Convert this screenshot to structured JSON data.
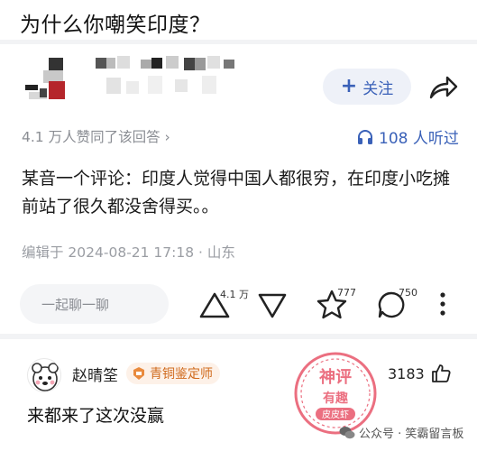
{
  "question": {
    "title": "为什么你嘲笑印度？"
  },
  "author": {
    "follow_label": "关注"
  },
  "stats": {
    "likes_text": "4.1 万人赞同了该回答 ›",
    "listen_text": "108 人听过"
  },
  "answer": {
    "body": "某音一个评论：印度人觉得中国人都很穷，在印度小吃摊前站了很久都没舍得买。。",
    "edit_meta": "编辑于 2024-08-21 17:18 · 山东"
  },
  "actions": {
    "chat_placeholder": "一起聊一聊",
    "upvotes": "4.1 万",
    "favorites": "777",
    "comments": "750"
  },
  "comment": {
    "author": "赵晴筌",
    "badge": "青铜鉴定师",
    "text": "来都来了这次没赢",
    "likes": "3183"
  },
  "watermark": {
    "stamp_lines": [
      "神评",
      "有趣",
      "皮皮虾"
    ],
    "footer": "公众号 · 笑霸留言板"
  },
  "colors": {
    "accent": "#3a61b8",
    "badge": "#d06a1c",
    "stamp": "#e8566b"
  }
}
